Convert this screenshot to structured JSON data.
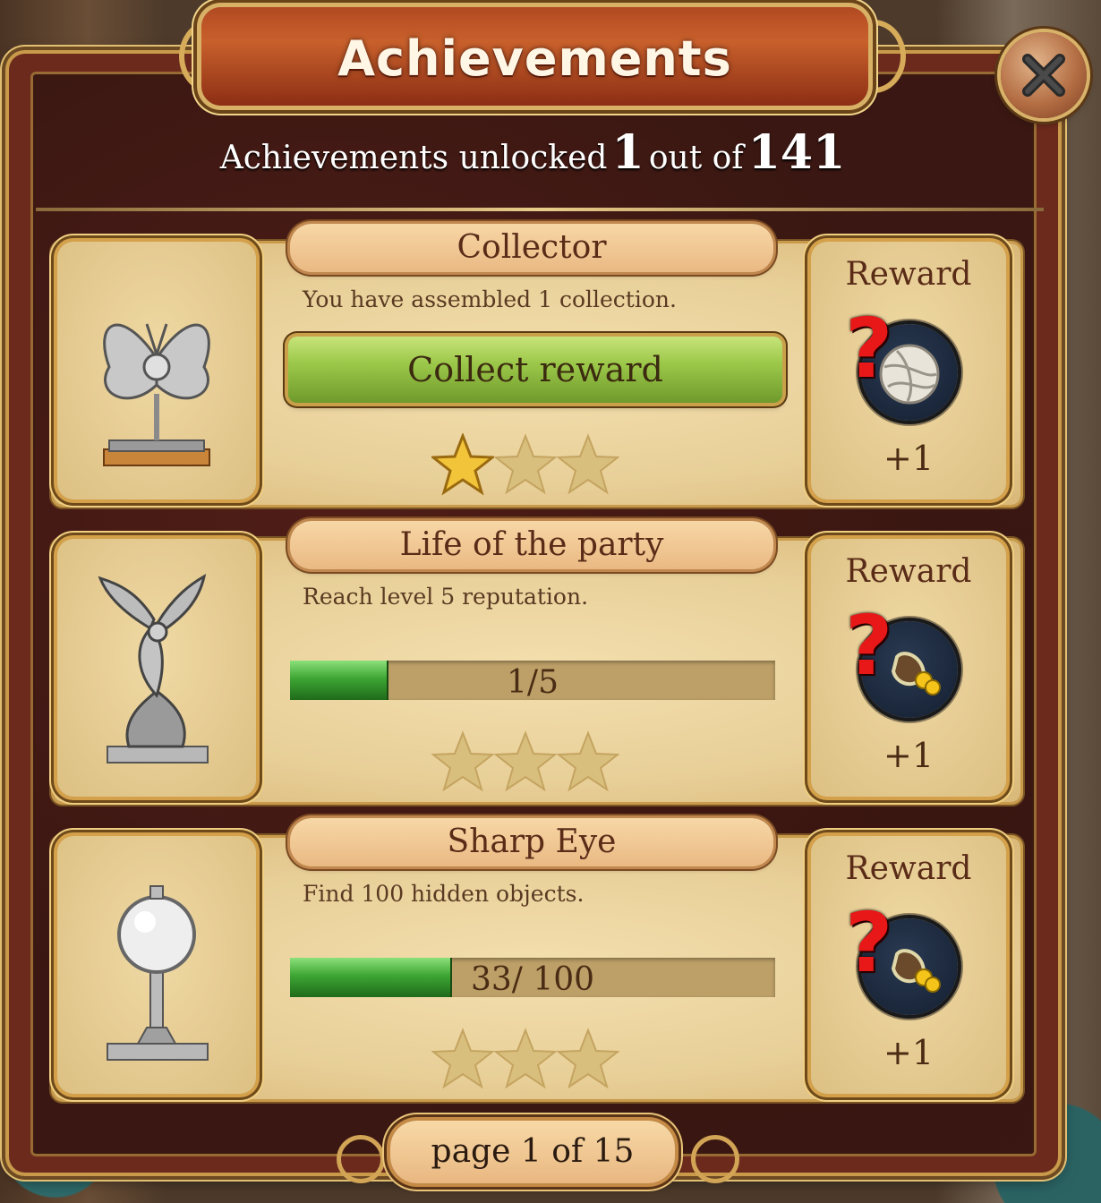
{
  "title": "Achievements",
  "summary": {
    "prefix": "Achievements unlocked",
    "unlocked": "1",
    "middle": "out of",
    "total": "141"
  },
  "achievements": [
    {
      "name": "Collector",
      "description": "You have assembled 1 collection.",
      "action_label": "Collect reward",
      "stars_earned": 1,
      "stars_total": 3,
      "reward_label": "Reward",
      "reward_item": "yarn-ball-icon",
      "reward_count": "+1"
    },
    {
      "name": "Life of the party",
      "description": "Reach level 5 reputation.",
      "progress_text": "1/5",
      "progress_value": 0.2,
      "stars_earned": 0,
      "stars_total": 3,
      "reward_label": "Reward",
      "reward_item": "earring-icon",
      "reward_count": "+1"
    },
    {
      "name": "Sharp Eye",
      "description": "Find 100 hidden objects.",
      "progress_text": "33/ 100",
      "progress_value": 0.33,
      "stars_earned": 0,
      "stars_total": 3,
      "reward_label": "Reward",
      "reward_item": "earring-icon",
      "reward_count": "+1"
    }
  ],
  "pager": {
    "text": "page 1 of 15"
  },
  "colors": {
    "title_banner": "#b24a22",
    "frame_gold": "#d8b066",
    "progress_green": "#3ea634",
    "star_gold": "#f2c43a",
    "question_red": "#e81818"
  }
}
